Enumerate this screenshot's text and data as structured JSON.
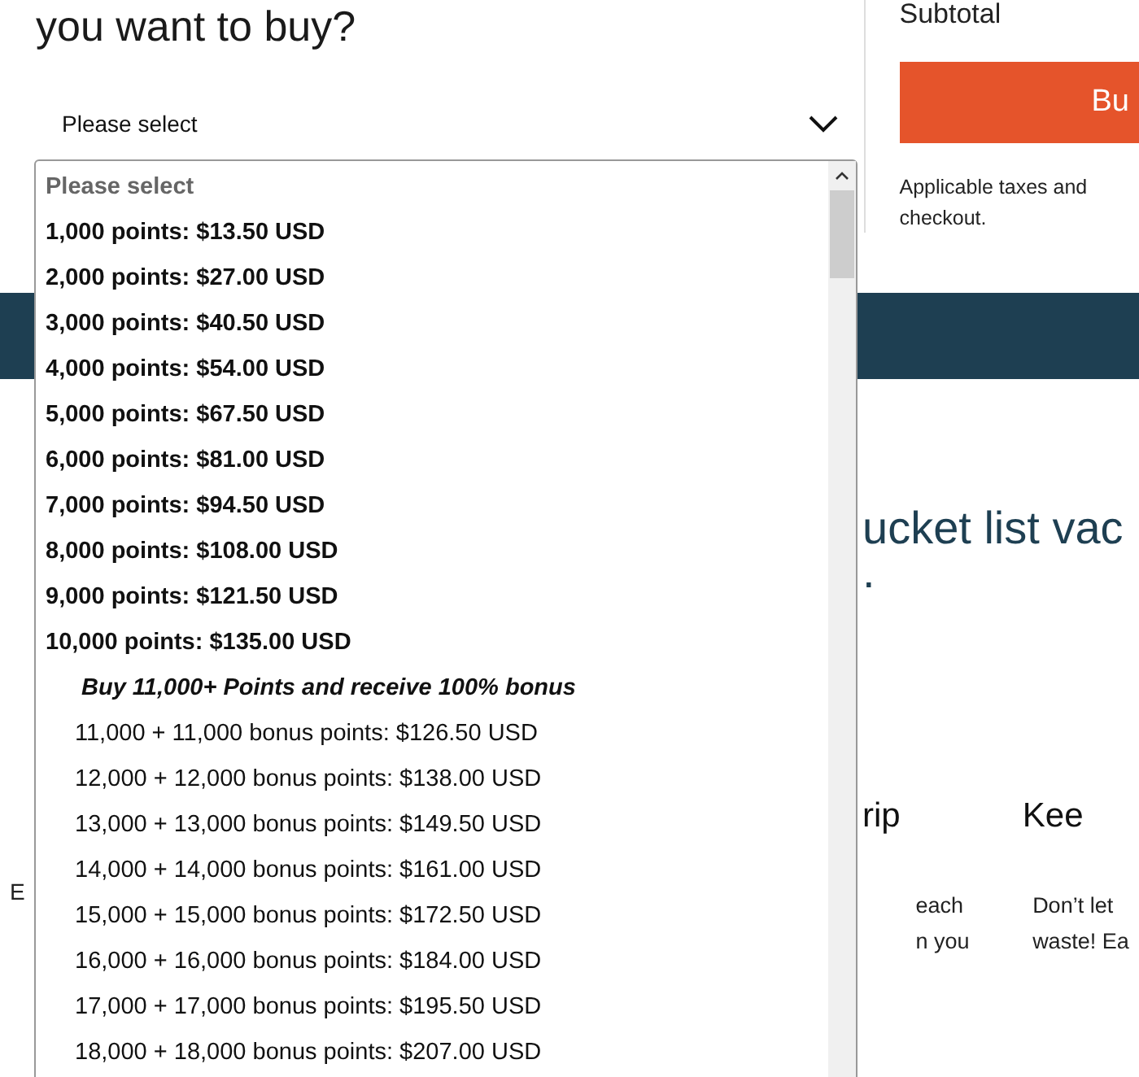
{
  "heading": "you want to buy?",
  "select": {
    "value": "Please select"
  },
  "options": [
    {
      "label": "Please select",
      "kind": "placeholder",
      "selected": false
    },
    {
      "label": "1,000 points: $13.50 USD",
      "kind": "points",
      "selected": false
    },
    {
      "label": "2,000 points: $27.00 USD",
      "kind": "points",
      "selected": false
    },
    {
      "label": "3,000 points: $40.50 USD",
      "kind": "points",
      "selected": false
    },
    {
      "label": "4,000 points: $54.00 USD",
      "kind": "points",
      "selected": false
    },
    {
      "label": "5,000 points: $67.50 USD",
      "kind": "points",
      "selected": false
    },
    {
      "label": "6,000 points: $81.00 USD",
      "kind": "points",
      "selected": false
    },
    {
      "label": "7,000 points: $94.50 USD",
      "kind": "points",
      "selected": false
    },
    {
      "label": "8,000 points: $108.00 USD",
      "kind": "points",
      "selected": false
    },
    {
      "label": "9,000 points: $121.50 USD",
      "kind": "points",
      "selected": false
    },
    {
      "label": "10,000 points: $135.00 USD",
      "kind": "points",
      "selected": false
    },
    {
      "label": "Buy 11,000+ Points and receive 100% bonus",
      "kind": "group",
      "selected": false
    },
    {
      "label": "11,000 + 11,000 bonus points: $126.50 USD",
      "kind": "bonus",
      "selected": false
    },
    {
      "label": "12,000 + 12,000 bonus points: $138.00 USD",
      "kind": "bonus",
      "selected": false
    },
    {
      "label": "13,000 + 13,000 bonus points: $149.50 USD",
      "kind": "bonus",
      "selected": false
    },
    {
      "label": "14,000 + 14,000 bonus points: $161.00 USD",
      "kind": "bonus",
      "selected": false
    },
    {
      "label": "15,000 + 15,000 bonus points: $172.50 USD",
      "kind": "bonus",
      "selected": false
    },
    {
      "label": "16,000 + 16,000 bonus points: $184.00 USD",
      "kind": "bonus",
      "selected": false
    },
    {
      "label": "17,000 + 17,000 bonus points: $195.50 USD",
      "kind": "bonus",
      "selected": false
    },
    {
      "label": "18,000 + 18,000 bonus points: $207.00 USD",
      "kind": "bonus",
      "selected": false
    }
  ],
  "summary": {
    "subtotal_label": "Subtotal",
    "buy_button": "Bu",
    "note": "Applicable taxes and checkout."
  },
  "promo": {
    "left_fragment": "E",
    "heading": "ucket list vac",
    "heading_line_2": ".",
    "features": [
      {
        "title": "rip",
        "text_lines": [
          "each",
          "n you"
        ]
      },
      {
        "title": "Kee",
        "text_lines": [
          "Don’t let",
          "waste! Ea"
        ]
      }
    ]
  }
}
